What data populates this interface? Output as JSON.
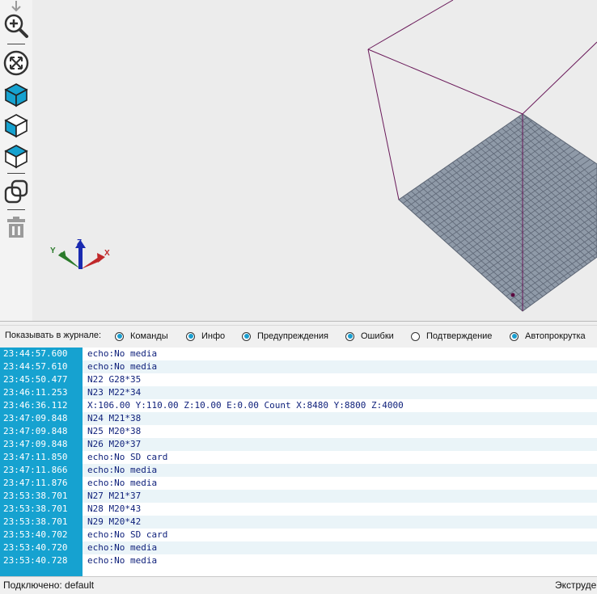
{
  "toolbar": {
    "tools": [
      {
        "name": "arrow-down-icon"
      },
      {
        "name": "zoom-in-icon"
      },
      {
        "name": "fit-view-icon"
      },
      {
        "name": "view-top-icon"
      },
      {
        "name": "view-front-icon"
      },
      {
        "name": "view-side-icon"
      },
      {
        "name": "copy-object-icon"
      },
      {
        "name": "delete-icon"
      }
    ]
  },
  "viewport": {
    "axes_labels": {
      "x": "X",
      "y": "Y",
      "z": "Z"
    },
    "colors": {
      "bed": "#8f9aa8",
      "frame": "#6a1a5a",
      "x_axis": "#c0282a",
      "y_axis": "#2a7a2a",
      "z_axis": "#1a2ab0"
    }
  },
  "log_filter": {
    "label": "Показывать в журнале:",
    "options": [
      {
        "label": "Команды",
        "checked": true
      },
      {
        "label": "Инфо",
        "checked": true
      },
      {
        "label": "Предупреждения",
        "checked": true
      },
      {
        "label": "Ошибки",
        "checked": true
      },
      {
        "label": "Подтверждение",
        "checked": false
      },
      {
        "label": "Автопрокрутка",
        "checked": true
      }
    ]
  },
  "log": [
    {
      "time": "23:44:57.600",
      "msg": "echo:No media"
    },
    {
      "time": "23:44:57.610",
      "msg": "echo:No media"
    },
    {
      "time": "23:45:50.477",
      "msg": "N22 G28*35"
    },
    {
      "time": "23:46:11.253",
      "msg": "N23 M22*34"
    },
    {
      "time": "23:46:36.112",
      "msg": "X:106.00 Y:110.00 Z:10.00 E:0.00 Count X:8480 Y:8800 Z:4000"
    },
    {
      "time": "23:47:09.848",
      "msg": "N24 M21*38"
    },
    {
      "time": "23:47:09.848",
      "msg": "N25 M20*38"
    },
    {
      "time": "23:47:09.848",
      "msg": "N26 M20*37"
    },
    {
      "time": "23:47:11.850",
      "msg": "echo:No SD card"
    },
    {
      "time": "23:47:11.866",
      "msg": "echo:No media"
    },
    {
      "time": "23:47:11.876",
      "msg": "echo:No media"
    },
    {
      "time": "23:53:38.701",
      "msg": "N27 M21*37"
    },
    {
      "time": "23:53:38.701",
      "msg": "N28 M20*43"
    },
    {
      "time": "23:53:38.701",
      "msg": "N29 M20*42"
    },
    {
      "time": "23:53:40.702",
      "msg": "echo:No SD card"
    },
    {
      "time": "23:53:40.720",
      "msg": "echo:No media"
    },
    {
      "time": "23:53:40.728",
      "msg": "echo:No media"
    }
  ],
  "status": {
    "connection": "Подключено: default",
    "right": "Экструдер"
  }
}
